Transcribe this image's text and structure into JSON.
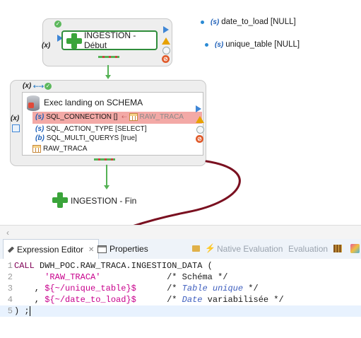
{
  "variables": [
    {
      "badge": "(s)",
      "text": "date_to_load [NULL]"
    },
    {
      "badge": "(s)",
      "text": "unique_table [NULL]"
    }
  ],
  "nodes": {
    "start": {
      "label": "INGESTION - Début",
      "badge": "(x)"
    },
    "exec": {
      "header_badge": "(x)",
      "title": "Exec landing on SCHEMA",
      "side_badge": "(x)",
      "params": [
        {
          "badge": "(s)",
          "text": "SQL_CONNECTION []",
          "link": "RAW_TRACA"
        },
        {
          "badge": "(s)",
          "text": "SQL_ACTION_TYPE [SELECT]"
        },
        {
          "badge": "(b)",
          "text": "SQL_MULTI_QUERYS [true]"
        }
      ],
      "table_label": "RAW_TRACA"
    },
    "end": {
      "label": "INGESTION - Fin"
    }
  },
  "tabs": {
    "expression_editor": "Expression Editor",
    "expression_editor_close": "✕",
    "properties": "Properties",
    "native_evaluation": "Native Evaluation",
    "evaluation": "Evaluation"
  },
  "code": {
    "line_numbers": [
      "1",
      "2",
      "3",
      "4",
      "5"
    ],
    "l1_kw": "CALL",
    "l1_rest": " DWH_POC.RAW_TRACA.INGESTION_DATA (",
    "l2_str": "'RAW_TRACA'",
    "l2_cm": "/* Schéma */",
    "l3_pre": "    , ",
    "l3_var": "${~/unique_table}$",
    "l3_cm_a": "/* ",
    "l3_cm_b": "Table unique",
    "l3_cm_c": " */",
    "l4_pre": "    , ",
    "l4_var": "${~/date_to_load}$",
    "l4_cm_a": "/* ",
    "l4_cm_b": "Date",
    "l4_cm_c": " variabilisée */",
    "l5": ") ;"
  },
  "colors": {
    "accent_green": "#2f8d3b",
    "annotation_arrow": "#7a1020",
    "selection_red": "#f3a9a6",
    "keyword": "#7f0055",
    "string": "#c8008c",
    "comment": "#3f5fbf"
  },
  "icons": [
    "plus-icon",
    "database-icon",
    "table-icon",
    "warning-icon",
    "stop-icon",
    "run-icon",
    "pencil-icon",
    "library-icon"
  ]
}
